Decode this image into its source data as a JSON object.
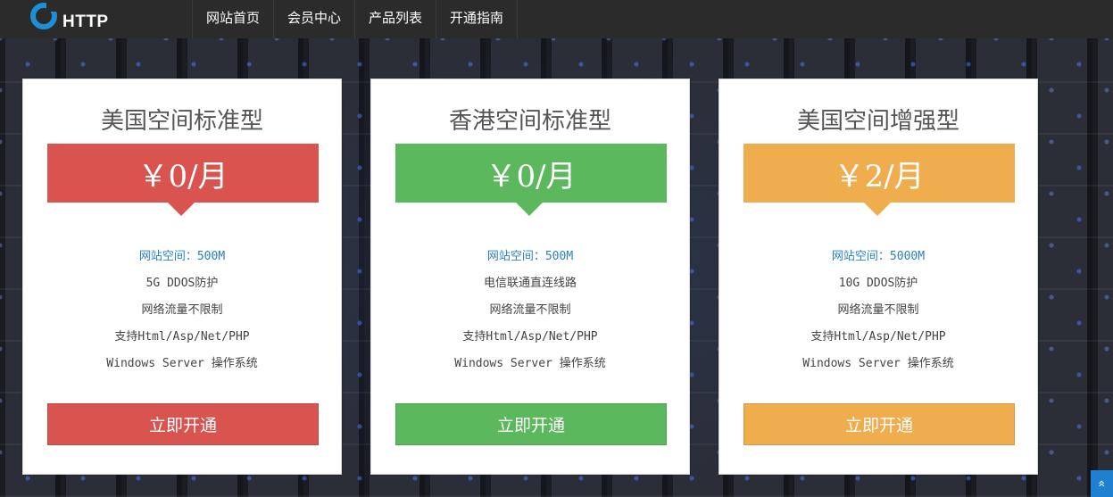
{
  "brand": {
    "logo_text": "HTTP",
    "accent_color": "#1c8fd6"
  },
  "nav": {
    "items": [
      {
        "label": "网站首页"
      },
      {
        "label": "会员中心"
      },
      {
        "label": "产品列表"
      },
      {
        "label": "开通指南"
      }
    ]
  },
  "plans": [
    {
      "title": "美国空间标准型",
      "price": "￥0/月",
      "color": "#d9534f",
      "features": [
        "网站空间：500M",
        "5G DDOS防护",
        "网络流量不限制",
        "支持Html/Asp/Net/PHP",
        "Windows Server 操作系统"
      ],
      "button_label": "立即开通"
    },
    {
      "title": "香港空间标准型",
      "price": "￥0/月",
      "color": "#5cb85c",
      "features": [
        "网站空间：500M",
        "电信联通直连线路",
        "网络流量不限制",
        "支持Html/Asp/Net/PHP",
        "Windows Server 操作系统"
      ],
      "button_label": "立即开通"
    },
    {
      "title": "美国空间增强型",
      "price": "￥2/月",
      "color": "#f0ad4e",
      "features": [
        "网站空间：5000M",
        "10G DDOS防护",
        "网络流量不限制",
        "支持Html/Asp/Net/PHP",
        "Windows Server 操作系统"
      ],
      "button_label": "立即开通"
    }
  ],
  "scroll_top": {
    "icon": "double-chevron-up-icon",
    "glyph": "»"
  }
}
